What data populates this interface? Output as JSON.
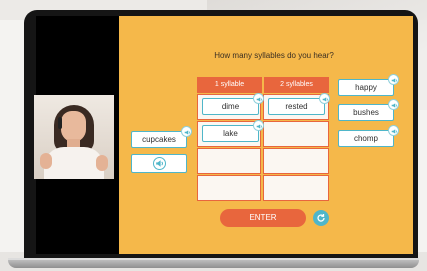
{
  "activity": {
    "question": "How many syllables do you hear?",
    "columns": [
      "1 syllable",
      "2 syllables"
    ],
    "placed": {
      "col1": [
        "dime",
        "lake"
      ],
      "col2": [
        "rested"
      ]
    },
    "word_bank_left": [
      "cupcakes"
    ],
    "word_bank_right": [
      "happy",
      "bushes",
      "chomp"
    ],
    "enter_label": "ENTER"
  },
  "colors": {
    "app_background": "#f5b84a",
    "accent_orange": "#e8663d",
    "chip_border": "#4fb6c9"
  },
  "icons": {
    "chip_audio": "speaker-icon",
    "play_audio": "speaker-icon",
    "reset": "refresh-icon"
  }
}
